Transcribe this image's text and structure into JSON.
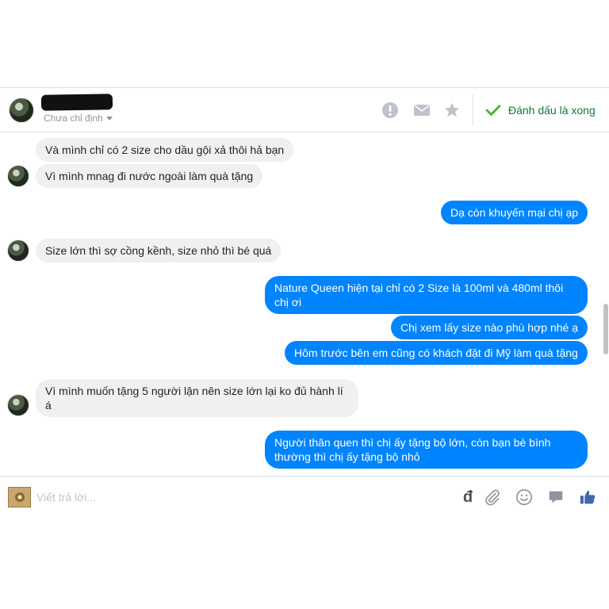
{
  "header": {
    "assign_status": "Chưa chỉ định",
    "done_label": "Đánh dấu là xong",
    "icons": [
      "alert-icon",
      "mail-icon",
      "star-icon",
      "check-icon"
    ]
  },
  "messages": [
    {
      "dir": "in",
      "text": "Và mình chỉ có 2 size cho dầu gội xả thôi hả bạn"
    },
    {
      "dir": "in",
      "text": "Vì mình mnag đi nước ngoài làm quà tặng"
    },
    {
      "dir": "out",
      "text": "Dạ còn khuyến mại chị ạp"
    },
    {
      "dir": "in",
      "text": "Size lớn thì sợ cồng kềnh, size nhỏ thì bé quá"
    },
    {
      "dir": "out",
      "text": "Nature Queen hiện tại chỉ có 2 Size là 100ml và 480ml thôi chị ơi"
    },
    {
      "dir": "out",
      "text": "Chị xem lấy size nào phù hợp nhé ạ"
    },
    {
      "dir": "out",
      "text": "Hôm trước bên em cũng có khách đặt đi Mỹ làm quà tặng"
    },
    {
      "dir": "in",
      "text": "Vì mình muốn tặng 5 người lận nên size lớn lại ko đủ hành lí á"
    },
    {
      "dir": "out",
      "text": "Người thân quen thì chị ấy tặng bộ lớn, còn bạn bè bình thường thì chị ấy tặng bộ nhỏ"
    }
  ],
  "composer": {
    "placeholder": "Viết trả lời...",
    "currency_symbol": "đ",
    "icons": [
      "currency-icon",
      "attachment-icon",
      "emoji-icon",
      "sticker-icon",
      "like-icon"
    ]
  },
  "colors": {
    "outgoing_bubble": "#0084ff",
    "incoming_bubble": "#f1f0f0",
    "done_check": "#42b72a",
    "like_icon": "#4267b2"
  }
}
